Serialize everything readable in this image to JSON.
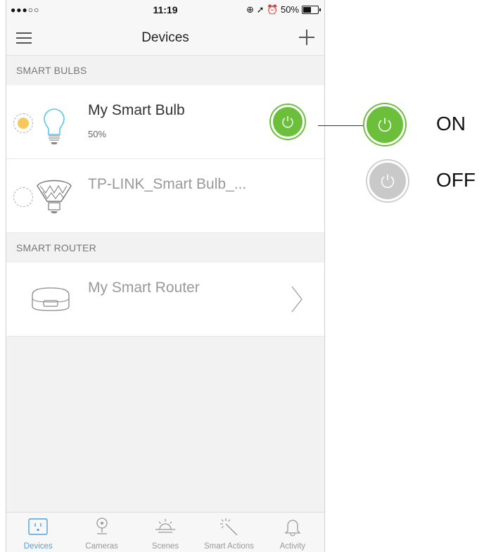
{
  "status": {
    "signal": "●●●○○",
    "time": "11:19",
    "right": "⊕ ➚ ⏰ 50%",
    "battery_level": 0.5
  },
  "nav": {
    "title": "Devices"
  },
  "sections": [
    {
      "header": "SMART BULBS"
    },
    {
      "header": "SMART ROUTER"
    }
  ],
  "devices": {
    "bulb1": {
      "name": "My Smart Bulb",
      "brightness": "50%",
      "state": "on"
    },
    "bulb2": {
      "name": "TP-LINK_Smart Bulb_...",
      "state": "off"
    },
    "router": {
      "name": "My Smart Router"
    }
  },
  "tabs": [
    {
      "label": "Devices",
      "icon": "outlet-icon",
      "active": true
    },
    {
      "label": "Cameras",
      "icon": "camera-icon"
    },
    {
      "label": "Scenes",
      "icon": "sunrise-icon"
    },
    {
      "label": "Smart Actions",
      "icon": "magic-wand-icon"
    },
    {
      "label": "Activity",
      "icon": "bell-icon"
    }
  ],
  "legend": {
    "on_label": "ON",
    "off_label": "OFF"
  },
  "colors": {
    "on_green": "#6bbf3a",
    "off_gray": "#c9c9c9",
    "active_tab": "#4aa3df",
    "bulb_yellow": "#f7c85c",
    "bulb_blue": "#5bc4e8"
  }
}
